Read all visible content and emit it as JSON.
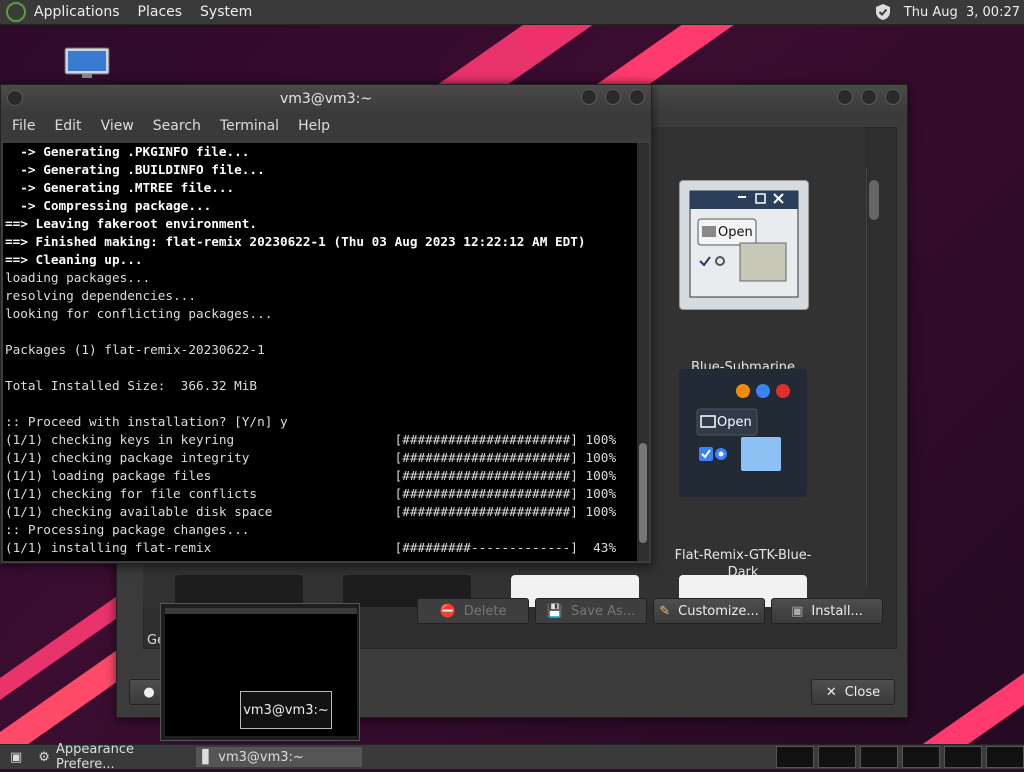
{
  "top_panel": {
    "menus": [
      "Applications",
      "Places",
      "System"
    ],
    "clock": "Thu Aug  3, 00:27"
  },
  "terminal": {
    "title": "vm3@vm3:~",
    "menu": [
      "File",
      "Edit",
      "View",
      "Search",
      "Terminal",
      "Help"
    ],
    "lines": [
      {
        "text": "  -> Generating .PKGINFO file...",
        "bold": true
      },
      {
        "text": "  -> Generating .BUILDINFO file...",
        "bold": true
      },
      {
        "text": "  -> Generating .MTREE file...",
        "bold": true
      },
      {
        "text": "  -> Compressing package...",
        "bold": true
      },
      {
        "text": "==> Leaving fakeroot environment.",
        "bold": true
      },
      {
        "text": "==> Finished making: flat-remix 20230622-1 (Thu 03 Aug 2023 12:22:12 AM EDT)",
        "bold": true
      },
      {
        "text": "==> Cleaning up...",
        "bold": true
      },
      {
        "text": "loading packages...",
        "bold": false
      },
      {
        "text": "resolving dependencies...",
        "bold": false
      },
      {
        "text": "looking for conflicting packages...",
        "bold": false
      },
      {
        "text": "",
        "bold": false
      },
      {
        "text": "Packages (1) flat-remix-20230622-1",
        "bold": false
      },
      {
        "text": "",
        "bold": false
      },
      {
        "text": "Total Installed Size:  366.32 MiB",
        "bold": false
      },
      {
        "text": "",
        "bold": false
      },
      {
        "text": ":: Proceed with installation? [Y/n] y",
        "bold": false
      },
      {
        "text": "(1/1) checking keys in keyring                     [######################] 100%",
        "bold": false
      },
      {
        "text": "(1/1) checking package integrity                   [######################] 100%",
        "bold": false
      },
      {
        "text": "(1/1) loading package files                        [######################] 100%",
        "bold": false
      },
      {
        "text": "(1/1) checking for file conflicts                  [######################] 100%",
        "bold": false
      },
      {
        "text": "(1/1) checking available disk space                [######################] 100%",
        "bold": false
      },
      {
        "text": ":: Processing package changes...",
        "bold": false
      },
      {
        "text": "(1/1) installing flat-remix                        [#########-------------]  43%",
        "bold": false
      }
    ]
  },
  "appearance": {
    "themes": [
      {
        "name": "Blue-Submarine",
        "open_label": "Open"
      },
      {
        "name": "Flat-Remix-GTK-Blue-Dark",
        "open_label": "Open"
      }
    ],
    "buttons": {
      "delete": "Delete",
      "save_as": "Save As...",
      "customize": "Customize...",
      "install": "Install...",
      "close": "Close"
    },
    "partial_label": "Ge"
  },
  "taskbar": {
    "tasks": [
      {
        "label": "Appearance Prefere..."
      },
      {
        "label": "vm3@vm3:~"
      }
    ]
  },
  "tooltip": "vm3@vm3:~"
}
